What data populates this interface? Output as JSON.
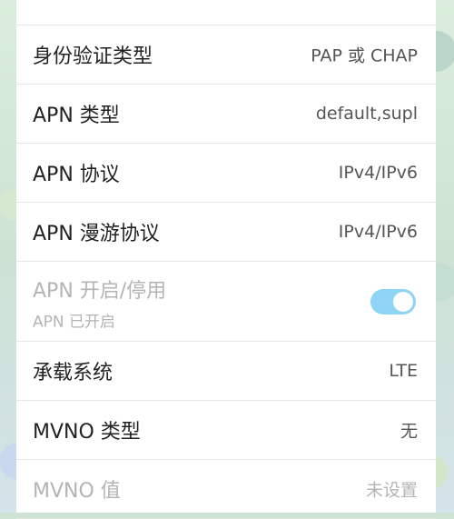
{
  "settings": {
    "rows": [
      {
        "label": "身份验证类型",
        "value": "PAP 或 CHAP"
      },
      {
        "label": "APN 类型",
        "value": "default,supl"
      },
      {
        "label": "APN 协议",
        "value": "IPv4/IPv6"
      },
      {
        "label": "APN 漫游协议",
        "value": "IPv4/IPv6"
      }
    ],
    "apn_toggle": {
      "label": "APN 开启/停用",
      "status": "APN 已开启",
      "enabled": true
    },
    "rows_after": [
      {
        "label": "承载系统",
        "value": "LTE"
      },
      {
        "label": "MVNO 类型",
        "value": "无"
      },
      {
        "label": "MVNO 值",
        "value": "未设置"
      }
    ]
  },
  "colors": {
    "toggle_on": "#8fd3f5",
    "text_primary": "#222222",
    "text_disabled": "#b4b4b4"
  }
}
